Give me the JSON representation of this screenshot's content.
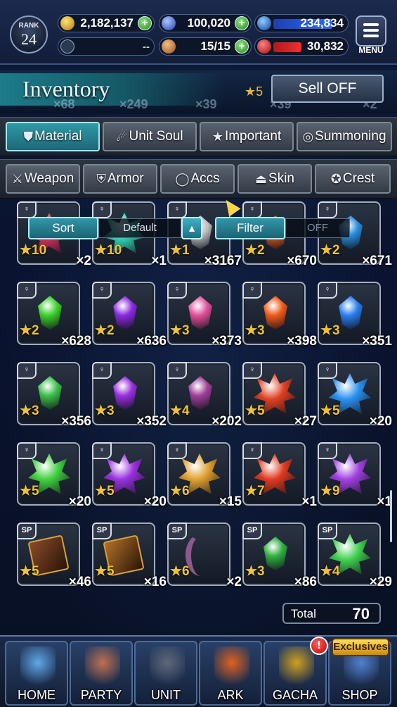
{
  "topbar": {
    "rank_label": "RANK",
    "rank_value": "24",
    "gil": "2,182,137",
    "lapis": "100,020",
    "blue_meter": "234,834",
    "unknown_resource": "--",
    "stamina": "15/15",
    "red_meter": "30,832",
    "menu_label": "MENU"
  },
  "title": {
    "text": "Inventory",
    "sell_label": "Sell OFF"
  },
  "category_tabs": [
    {
      "label": "Material",
      "icon": "bag-icon",
      "active": true
    },
    {
      "label": "Unit Soul",
      "icon": "soul-icon",
      "active": false
    },
    {
      "label": "Important",
      "icon": "star-icon",
      "active": false
    },
    {
      "label": "Summoning",
      "icon": "summon-icon",
      "active": false
    }
  ],
  "equip_tabs": [
    {
      "label": "Weapon",
      "icon": "sword-icon"
    },
    {
      "label": "Armor",
      "icon": "armor-icon"
    },
    {
      "label": "Accs",
      "icon": "ring-icon"
    },
    {
      "label": "Skin",
      "icon": "hanger-icon"
    },
    {
      "label": "Crest",
      "icon": "crest-icon"
    }
  ],
  "sort": {
    "sort_label": "Sort",
    "sort_value": "Default",
    "arrow": "▲",
    "filter_label": "Filter",
    "filter_value": "OFF"
  },
  "items": [
    {
      "star": "★10",
      "qty": "×2",
      "color": "#d0305a",
      "shape": "cluster",
      "tag": "♀"
    },
    {
      "star": "★10",
      "qty": "×1",
      "color": "#30d0b0",
      "shape": "cluster",
      "tag": "♀"
    },
    {
      "star": "★1",
      "qty": "×3167",
      "color": "#c0c0c0",
      "shape": "gem",
      "tag": "♀"
    },
    {
      "star": "★2",
      "qty": "×670",
      "color": "#e05a20",
      "shape": "gem",
      "tag": "♀"
    },
    {
      "star": "★2",
      "qty": "×671",
      "color": "#2a8fe0",
      "shape": "gem",
      "tag": "♀"
    },
    {
      "star": "★2",
      "qty": "×628",
      "color": "#3cd02a",
      "shape": "gem",
      "tag": "♀"
    },
    {
      "star": "★2",
      "qty": "×636",
      "color": "#8a2ae0",
      "shape": "gem",
      "tag": "♀"
    },
    {
      "star": "★3",
      "qty": "×373",
      "color": "#e0509a",
      "shape": "gem",
      "tag": "♀"
    },
    {
      "star": "★3",
      "qty": "×398",
      "color": "#f05a1a",
      "shape": "gem",
      "tag": "♀"
    },
    {
      "star": "★3",
      "qty": "×351",
      "color": "#2a7ff0",
      "shape": "gem",
      "tag": "♀"
    },
    {
      "star": "★3",
      "qty": "×356",
      "color": "#3cc04a",
      "shape": "gem",
      "tag": "♀"
    },
    {
      "star": "★3",
      "qty": "×352",
      "color": "#9a30e0",
      "shape": "gem",
      "tag": "♀"
    },
    {
      "star": "★4",
      "qty": "×202",
      "color": "#a0409a",
      "shape": "gem",
      "tag": "♀"
    },
    {
      "star": "★5",
      "qty": "×27",
      "color": "#e04020",
      "shape": "cluster",
      "tag": "♀"
    },
    {
      "star": "★5",
      "qty": "×20",
      "color": "#2a90f0",
      "shape": "cluster",
      "tag": "♀"
    },
    {
      "star": "★5",
      "qty": "×20",
      "color": "#40d040",
      "shape": "cluster",
      "tag": "♀"
    },
    {
      "star": "★5",
      "qty": "×20",
      "color": "#9a30e0",
      "shape": "cluster",
      "tag": "♀"
    },
    {
      "star": "★6",
      "qty": "×15",
      "color": "#e0a030",
      "shape": "cluster",
      "tag": "♀"
    },
    {
      "star": "★7",
      "qty": "×1",
      "color": "#e03a20",
      "shape": "cluster",
      "tag": "♀"
    },
    {
      "star": "★9",
      "qty": "×1",
      "color": "#a040e0",
      "shape": "cluster",
      "tag": "♀"
    },
    {
      "star": "★5",
      "qty": "×46",
      "color": "#8a4a2a",
      "shape": "book",
      "tag": "SP"
    },
    {
      "star": "★5",
      "qty": "×16",
      "color": "#b07028",
      "shape": "book",
      "tag": "SP"
    },
    {
      "star": "★6",
      "qty": "×2",
      "color": "#8a5a8a",
      "shape": "sword",
      "tag": "SP"
    },
    {
      "star": "★3",
      "qty": "×86",
      "color": "#30b040",
      "shape": "gem",
      "tag": "SP"
    },
    {
      "star": "★4",
      "qty": "×29",
      "color": "#40d050",
      "shape": "cluster",
      "tag": "SP"
    }
  ],
  "total": {
    "label": "Total",
    "value": "70"
  },
  "nav": [
    {
      "label": "HOME",
      "color": "#5fa8e8"
    },
    {
      "label": "PARTY",
      "color": "#c07050"
    },
    {
      "label": "UNIT",
      "color": "#606878"
    },
    {
      "label": "ARK",
      "color": "#e06020"
    },
    {
      "label": "GACHA",
      "color": "#d0a020"
    },
    {
      "label": "SHOP",
      "color": "#5080d0"
    }
  ],
  "shop_badge": "Exclusives",
  "alert": "!",
  "ghost_counts": [
    "×68",
    "×249",
    "×39",
    "×39",
    "×2"
  ],
  "ghost_star": "★5"
}
